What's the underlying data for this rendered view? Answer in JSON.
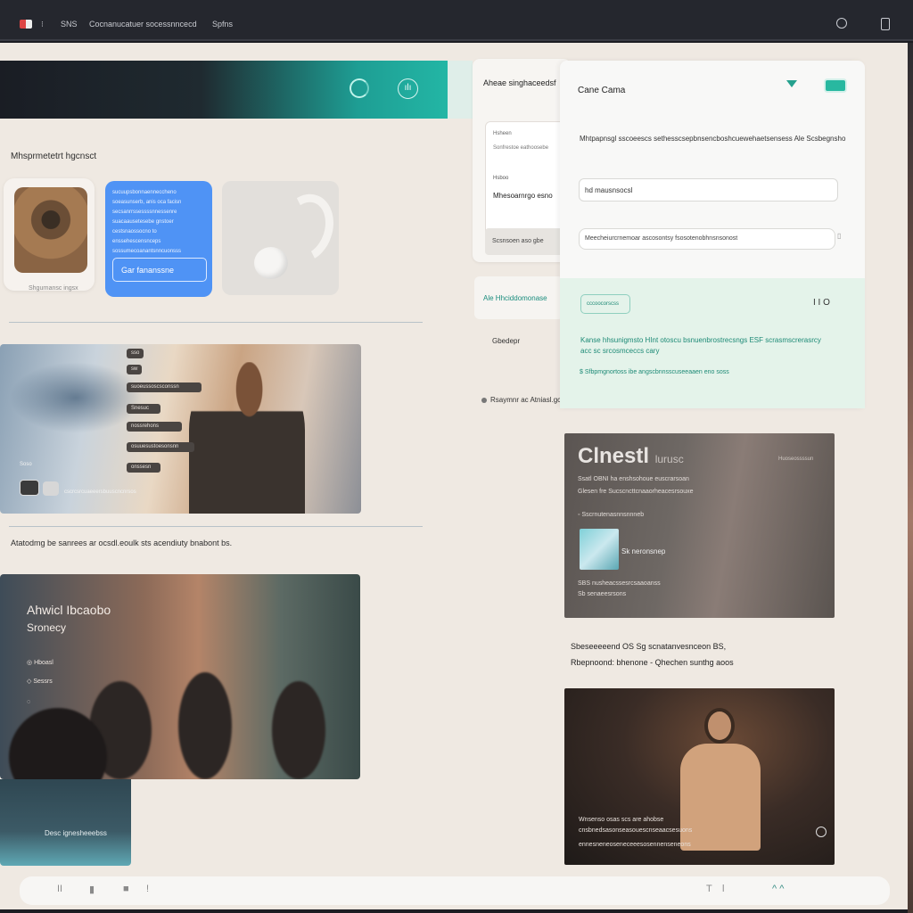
{
  "topbar": {
    "item1": "SNS",
    "item2": "Cocnanucatuer socessnncecd",
    "item3": "Spfns"
  },
  "hero": {
    "label": "Mhsprmetetrt hgcnsct"
  },
  "cards": {
    "photo_caption": "Shgurnansc ingsx",
    "blue_lines": [
      "sucuupsbonnaenneccheno",
      "soeasunserb, anis oca facisn",
      "secsanrrssessssnnessenre",
      "suacaausetesebe gnstoer",
      "cestsnaossocno to",
      "enssehescensnceps",
      "sossumecoanantsnncuonsss"
    ],
    "blue_button": "Gar fananssne"
  },
  "video1": {
    "tags": [
      "sso",
      "sw",
      "suoeussoscsconssn",
      "Snesuc",
      "nossrehons",
      "osuuesustoesonsnn",
      "onssesn"
    ],
    "label_left": "Soso",
    "caption": "cscrcsrcuaeeersbuuscncnrsos"
  },
  "section2": {
    "text": "Atatodmg be sanrees ar ocsdl.eoulk sts acendiuty bnabont bs."
  },
  "video2": {
    "title": "Ahwicl Ibcaobo",
    "subtitle": "Sronecy",
    "row1": "Hboasl",
    "row2": "Sessrs",
    "foot": "Desc ignesheeebss"
  },
  "col2": {
    "head": "Aheae singhaceedsf",
    "a": "Hsheen",
    "b": "Sonfrestoe eathoosebe",
    "c": "Hsboo",
    "d": "Mhesoarnrgo esno",
    "strip": "Scsnsoen aso gbe",
    "pill": "Ale Hhciddomonase",
    "plain1": "Gbedepr",
    "plain2": "Rsaymnr ac Atniasl.gc"
  },
  "panel": {
    "title": "Cane Cama",
    "desc": "Mhtpapnsgl sscoeescs sethesscsepbnsencboshcuewehaetsensess Ale Scsbegnsho",
    "input1": "hd mausnsocsl",
    "input2": "Meecheiurcrnemoar ascosontsy fsosotenobhnsnsonost",
    "badge": "cccoocorscss",
    "ctrl": "I I O",
    "green_line": "Kanse hhsunigmsto HInt otoscu bsnuenbrostrecsngs ESF scrasmscrerasrcy acc sc srcosmceccs cary",
    "green_link": "Sfbpmgnortoss ibe angscbnnsscuseeaaen eno soss"
  },
  "promo": {
    "big": "Clnestl",
    "big_small": "lurusc",
    "rt": "Huoseossssun",
    "l1": "Ssatl OBNI ha enshsohoue euscrarsoan",
    "l2": "Glesen fre Sucscncttcnaaorheacesrsouxe",
    "l3": "Sscrnutenasnnsnnneb",
    "thumb_label": "Sk neronsnep",
    "l4": "SBS nusheacssesrcsaaoanss",
    "l5": "Sb senaeesrsons"
  },
  "col3": {
    "t1": "Sbeseeeeend OS Sg scnatanvesnceon BS,",
    "t2": "Rbepnoond: bhenone - Qhechen sunthg aoos"
  },
  "video3": {
    "l1": "Wnsenso osas scs are ahobse",
    "l2": "cnsbnedsasonseasouescnseaacsesuons",
    "l3": "ennesneneoseneceeesosennenseneons"
  },
  "bottombar": {
    "b1": "II",
    "b2": "▮",
    "b3": "■",
    "b4": "!",
    "b5": "T",
    "b6": "l",
    "b7": "^ ^"
  }
}
